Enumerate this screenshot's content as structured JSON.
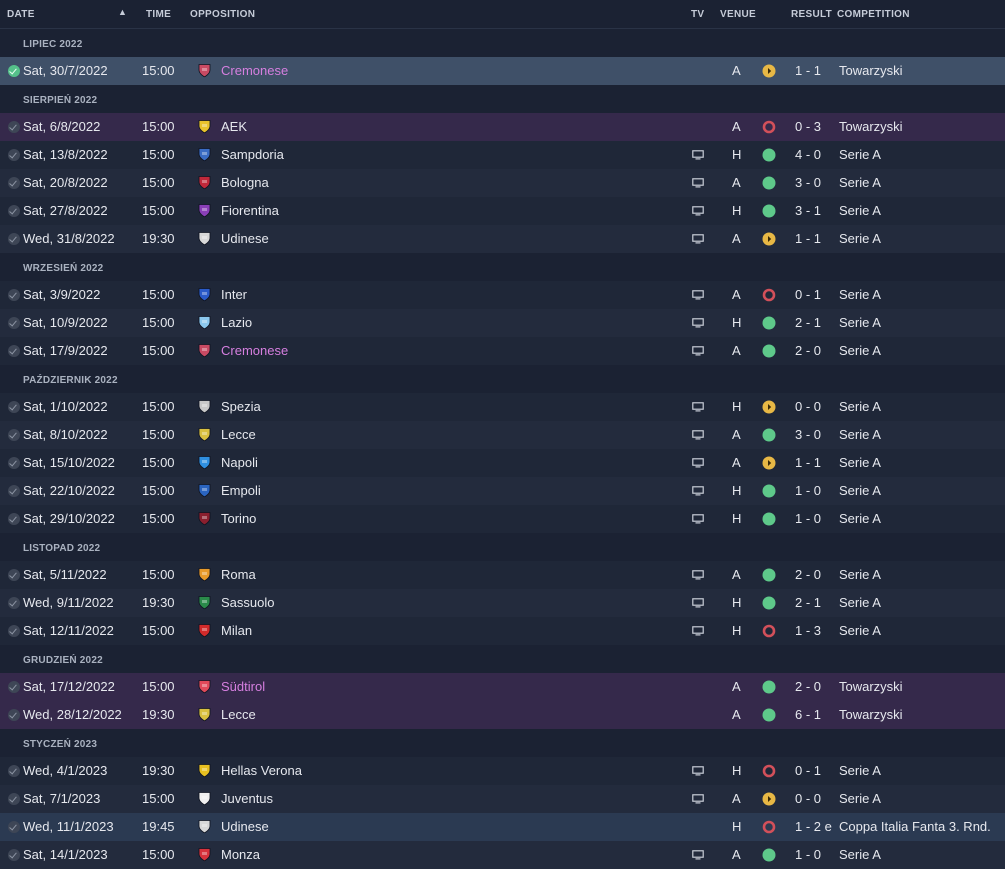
{
  "header": {
    "date": "DATE",
    "time": "TIME",
    "opposition": "OPPOSITION",
    "tv": "TV",
    "venue": "VENUE",
    "result": "RESULT",
    "competition": "COMPETITION"
  },
  "colors": {
    "win": "#5ec98a",
    "draw": "#e8b845",
    "loss": "#d2505a",
    "friendly_row": "#35294b",
    "selected_row": "#3f5068",
    "highlight_team": "#d67fe0"
  },
  "sections": [
    {
      "month": "LIPIEC 2022",
      "matches": [
        {
          "date": "Sat, 30/7/2022",
          "time": "15:00",
          "team": "Cremonese",
          "crest": "cremonese-crest",
          "crest_color": "#c94a63",
          "tv": false,
          "venue": "A",
          "result": "draw",
          "score": "1 - 1",
          "competition": "Towarzyski",
          "row_style": "selected",
          "highlight": true
        }
      ]
    },
    {
      "month": "SIERPIEŃ 2022",
      "matches": [
        {
          "date": "Sat, 6/8/2022",
          "time": "15:00",
          "team": "AEK",
          "crest": "aek-crest",
          "crest_color": "#e8c32c",
          "tv": false,
          "venue": "A",
          "result": "loss",
          "score": "0 - 3",
          "competition": "Towarzyski",
          "row_style": "friendly",
          "highlight": false
        },
        {
          "date": "Sat, 13/8/2022",
          "time": "15:00",
          "team": "Sampdoria",
          "crest": "sampdoria-crest",
          "crest_color": "#3a6cc4",
          "tv": true,
          "venue": "H",
          "result": "win",
          "score": "4 - 0",
          "competition": "Serie A",
          "row_style": "odd",
          "highlight": false
        },
        {
          "date": "Sat, 20/8/2022",
          "time": "15:00",
          "team": "Bologna",
          "crest": "bologna-crest",
          "crest_color": "#c0283a",
          "tv": true,
          "venue": "A",
          "result": "win",
          "score": "3 - 0",
          "competition": "Serie A",
          "row_style": "even",
          "highlight": false
        },
        {
          "date": "Sat, 27/8/2022",
          "time": "15:00",
          "team": "Fiorentina",
          "crest": "fiorentina-crest",
          "crest_color": "#8a3fb8",
          "tv": true,
          "venue": "H",
          "result": "win",
          "score": "3 - 1",
          "competition": "Serie A",
          "row_style": "odd",
          "highlight": false
        },
        {
          "date": "Wed, 31/8/2022",
          "time": "19:30",
          "team": "Udinese",
          "crest": "udinese-crest",
          "crest_color": "#d8d8d8",
          "tv": true,
          "venue": "A",
          "result": "draw",
          "score": "1 - 1",
          "competition": "Serie A",
          "row_style": "even",
          "highlight": false
        }
      ]
    },
    {
      "month": "WRZESIEŃ 2022",
      "matches": [
        {
          "date": "Sat, 3/9/2022",
          "time": "15:00",
          "team": "Inter",
          "crest": "inter-crest",
          "crest_color": "#2a5ac8",
          "tv": true,
          "venue": "A",
          "result": "loss",
          "score": "0 - 1",
          "competition": "Serie A",
          "row_style": "odd",
          "highlight": false
        },
        {
          "date": "Sat, 10/9/2022",
          "time": "15:00",
          "team": "Lazio",
          "crest": "lazio-crest",
          "crest_color": "#8cc8ee",
          "tv": true,
          "venue": "H",
          "result": "win",
          "score": "2 - 1",
          "competition": "Serie A",
          "row_style": "even",
          "highlight": false
        },
        {
          "date": "Sat, 17/9/2022",
          "time": "15:00",
          "team": "Cremonese",
          "crest": "cremonese-crest",
          "crest_color": "#c94a63",
          "tv": true,
          "venue": "A",
          "result": "win",
          "score": "2 - 0",
          "competition": "Serie A",
          "row_style": "odd",
          "highlight": true
        }
      ]
    },
    {
      "month": "PAŹDZIERNIK 2022",
      "matches": [
        {
          "date": "Sat, 1/10/2022",
          "time": "15:00",
          "team": "Spezia",
          "crest": "spezia-crest",
          "crest_color": "#c8c8c8",
          "tv": true,
          "venue": "H",
          "result": "draw",
          "score": "0 - 0",
          "competition": "Serie A",
          "row_style": "odd",
          "highlight": false
        },
        {
          "date": "Sat, 8/10/2022",
          "time": "15:00",
          "team": "Lecce",
          "crest": "lecce-crest",
          "crest_color": "#d9c040",
          "tv": true,
          "venue": "A",
          "result": "win",
          "score": "3 - 0",
          "competition": "Serie A",
          "row_style": "even",
          "highlight": false
        },
        {
          "date": "Sat, 15/10/2022",
          "time": "15:00",
          "team": "Napoli",
          "crest": "napoli-crest",
          "crest_color": "#2f8fe0",
          "tv": true,
          "venue": "A",
          "result": "draw",
          "score": "1 - 1",
          "competition": "Serie A",
          "row_style": "odd",
          "highlight": false
        },
        {
          "date": "Sat, 22/10/2022",
          "time": "15:00",
          "team": "Empoli",
          "crest": "empoli-crest",
          "crest_color": "#2a64c0",
          "tv": true,
          "venue": "H",
          "result": "win",
          "score": "1 - 0",
          "competition": "Serie A",
          "row_style": "even",
          "highlight": false
        },
        {
          "date": "Sat, 29/10/2022",
          "time": "15:00",
          "team": "Torino",
          "crest": "torino-crest",
          "crest_color": "#8a1f2e",
          "tv": true,
          "venue": "H",
          "result": "win",
          "score": "1 - 0",
          "competition": "Serie A",
          "row_style": "odd",
          "highlight": false
        }
      ]
    },
    {
      "month": "LISTOPAD 2022",
      "matches": [
        {
          "date": "Sat, 5/11/2022",
          "time": "15:00",
          "team": "Roma",
          "crest": "roma-crest",
          "crest_color": "#e89a2a",
          "tv": true,
          "venue": "A",
          "result": "win",
          "score": "2 - 0",
          "competition": "Serie A",
          "row_style": "odd",
          "highlight": false
        },
        {
          "date": "Wed, 9/11/2022",
          "time": "19:30",
          "team": "Sassuolo",
          "crest": "sassuolo-crest",
          "crest_color": "#2a8a4a",
          "tv": true,
          "venue": "H",
          "result": "win",
          "score": "2 - 1",
          "competition": "Serie A",
          "row_style": "even",
          "highlight": false
        },
        {
          "date": "Sat, 12/11/2022",
          "time": "15:00",
          "team": "Milan",
          "crest": "milan-crest",
          "crest_color": "#d22a2a",
          "tv": true,
          "venue": "H",
          "result": "loss",
          "score": "1 - 3",
          "competition": "Serie A",
          "row_style": "odd",
          "highlight": false
        }
      ]
    },
    {
      "month": "GRUDZIEŃ 2022",
      "matches": [
        {
          "date": "Sat, 17/12/2022",
          "time": "15:00",
          "team": "Südtirol",
          "crest": "sudtirol-crest",
          "crest_color": "#e04a5a",
          "tv": false,
          "venue": "A",
          "result": "win",
          "score": "2 - 0",
          "competition": "Towarzyski",
          "row_style": "friendly",
          "highlight": true
        },
        {
          "date": "Wed, 28/12/2022",
          "time": "19:30",
          "team": "Lecce",
          "crest": "lecce-crest",
          "crest_color": "#d9c040",
          "tv": false,
          "venue": "A",
          "result": "win",
          "score": "6 - 1",
          "competition": "Towarzyski",
          "row_style": "friendly",
          "highlight": false
        }
      ]
    },
    {
      "month": "STYCZEŃ 2023",
      "matches": [
        {
          "date": "Wed, 4/1/2023",
          "time": "19:30",
          "team": "Hellas Verona",
          "crest": "verona-crest",
          "crest_color": "#e8c020",
          "tv": true,
          "venue": "H",
          "result": "loss",
          "score": "0 - 1",
          "competition": "Serie A",
          "row_style": "odd",
          "highlight": false
        },
        {
          "date": "Sat, 7/1/2023",
          "time": "15:00",
          "team": "Juventus",
          "crest": "juventus-crest",
          "crest_color": "#f0f0f0",
          "tv": true,
          "venue": "A",
          "result": "draw",
          "score": "0 - 0",
          "competition": "Serie A",
          "row_style": "even",
          "highlight": false
        },
        {
          "date": "Wed, 11/1/2023",
          "time": "19:45",
          "team": "Udinese",
          "crest": "udinese-crest",
          "crest_color": "#d8d8d8",
          "tv": false,
          "venue": "H",
          "result": "loss",
          "score": "1 - 2 e",
          "competition": "Coppa Italia Fanta 3. Rnd.",
          "row_style": "cup",
          "highlight": false
        },
        {
          "date": "Sat, 14/1/2023",
          "time": "15:00",
          "team": "Monza",
          "crest": "monza-crest",
          "crest_color": "#d8323c",
          "tv": true,
          "venue": "A",
          "result": "win",
          "score": "1 - 0",
          "competition": "Serie A",
          "row_style": "even",
          "highlight": false
        }
      ]
    }
  ]
}
